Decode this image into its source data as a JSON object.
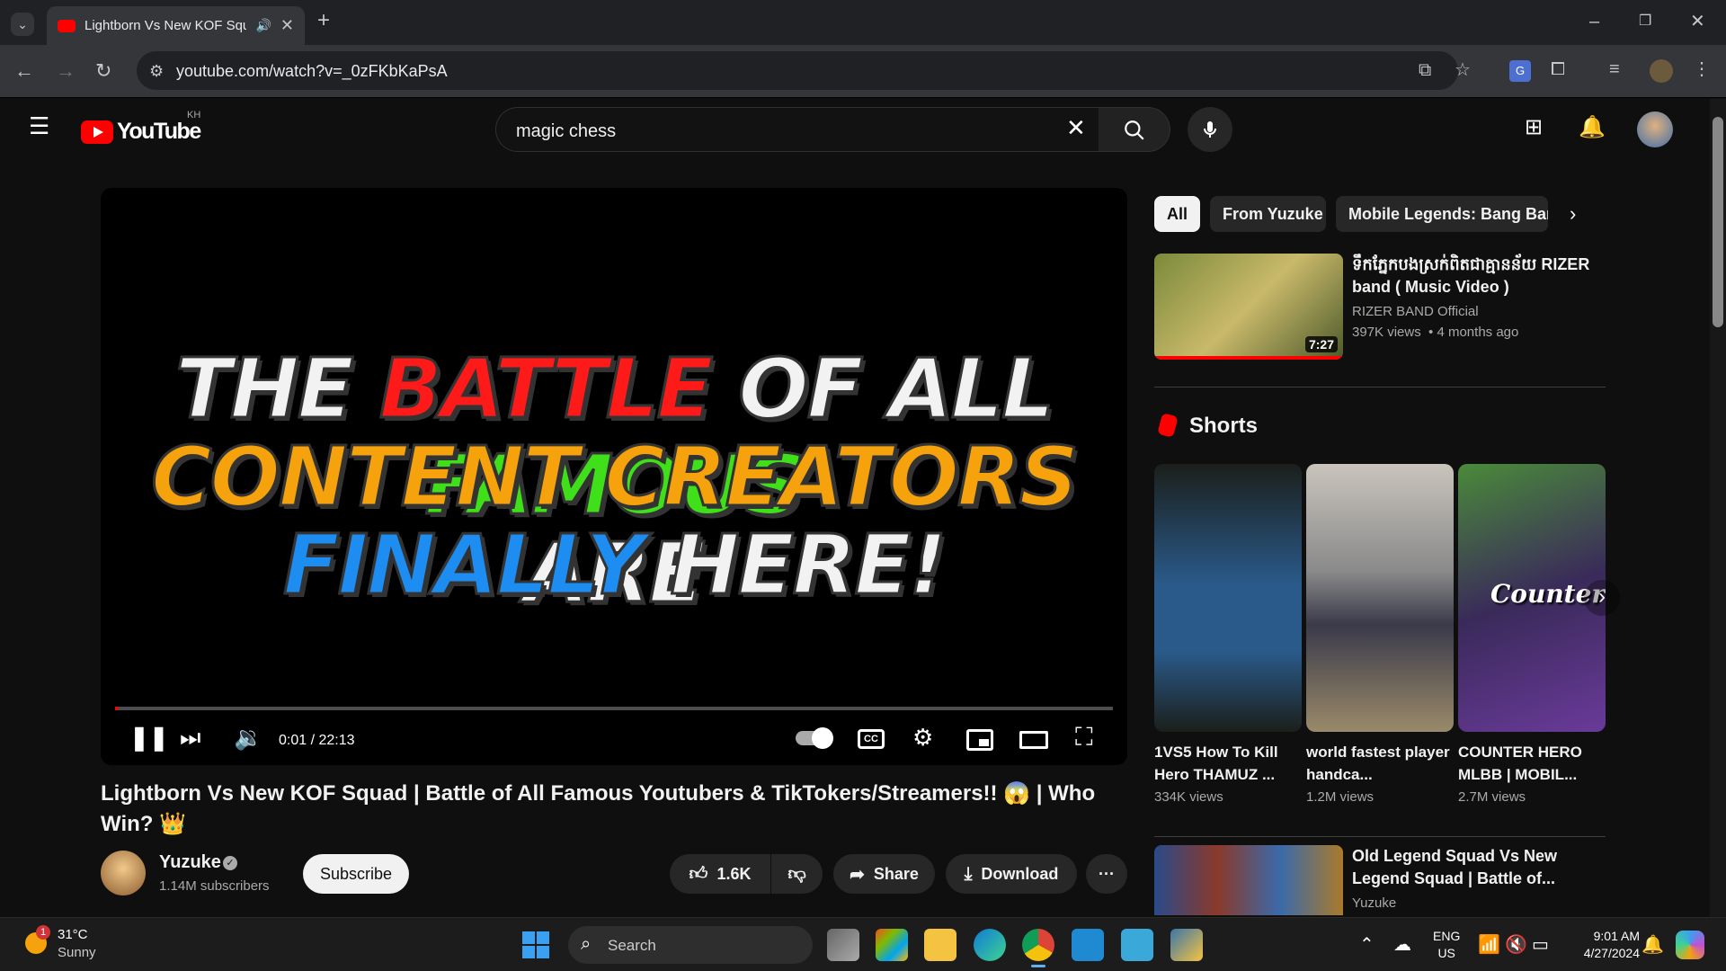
{
  "browser": {
    "tab_title": "Lightborn Vs New KOF Squad",
    "url": "youtube.com/watch?v=_0zFKbKaPsA"
  },
  "youtube": {
    "logo_text": "YouTube",
    "country_code": "KH",
    "search_value": "magic chess"
  },
  "player": {
    "thumbnail_lines": [
      [
        {
          "t": "THE ",
          "c": "#f2f2f2"
        },
        {
          "t": "BATTLE ",
          "c": "#ff1a1a"
        },
        {
          "t": "OF ALL ",
          "c": "#f2f2f2"
        },
        {
          "t": "FAMOUS",
          "c": "#3fe01a"
        }
      ],
      [
        {
          "t": "CONTENT CREATORS ",
          "c": "#f5a20c"
        },
        {
          "t": "ARE",
          "c": "#f2f2f2"
        }
      ],
      [
        {
          "t": "FINALLY ",
          "c": "#1d8df2"
        },
        {
          "t": "HERE!",
          "c": "#f2f2f2"
        }
      ]
    ],
    "time": "0:01 / 22:13",
    "progress_fraction": 0.001
  },
  "video": {
    "title": "Lightborn Vs New KOF Squad | Battle of All Famous Youtubers & TikTokers/Streamers!! 😱 | Who Win? 👑",
    "channel": "Yuzuke",
    "subscribers": "1.14M subscribers",
    "subscribe_label": "Subscribe",
    "likes": "1.6K",
    "share_label": "Share",
    "download_label": "Download"
  },
  "sidebar": {
    "chips": [
      "All",
      "From Yuzuke",
      "Mobile Legends: Bang Bang"
    ],
    "rec1": {
      "title": "ទឹកភ្នែកបងស្រក់ពិតជាគ្មានន័យ RIZER band ( Music Video )",
      "channel": "RIZER BAND Official",
      "meta": "397K views  • 4 months ago",
      "duration": "7:27"
    },
    "shorts_heading": "Shorts",
    "shorts": [
      {
        "title": "1VS5 How To Kill Hero THAMUZ ...",
        "views": "334K views"
      },
      {
        "title": "world fastest player handca...",
        "views": "1.2M views"
      },
      {
        "title": "COUNTER HERO MLBB | MOBIL...",
        "views": "2.7M views",
        "overlay": "Counter"
      }
    ],
    "rec2": {
      "title": "Old Legend Squad Vs New Legend Squad | Battle of...",
      "channel": "Yuzuke"
    }
  },
  "taskbar": {
    "weather_temp": "31°C",
    "weather_desc": "Sunny",
    "weather_badge": "1",
    "search_label": "Search",
    "lang1": "ENG",
    "lang2": "US",
    "time": "9:01 AM",
    "date": "4/27/2024"
  },
  "colors": {
    "accent_red": "#ff0000",
    "bg": "#0f0f0f",
    "chip_bg": "#272727"
  }
}
